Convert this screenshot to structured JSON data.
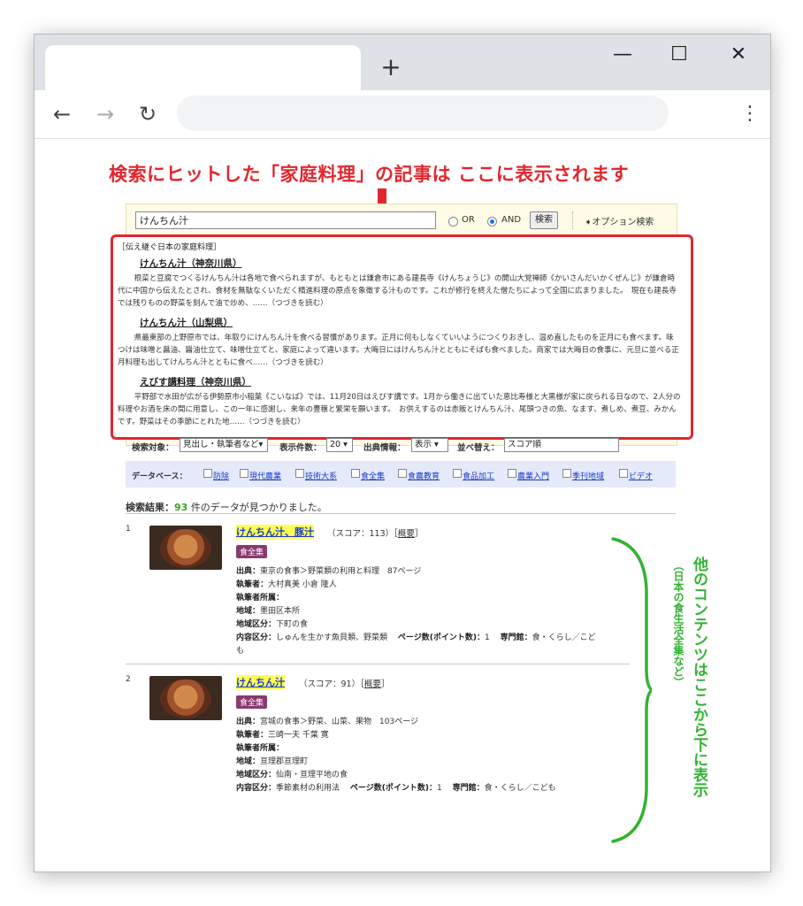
{
  "browser": {
    "new_tab": "+",
    "back": "←",
    "forward": "→",
    "reload": "↻",
    "menu": "⋮",
    "minimize": "—",
    "maximize": "☐",
    "close": "✕"
  },
  "banner": "検索にヒットした「家庭料理」の記事は ここに表示されます",
  "search": {
    "query": "けんちん汁",
    "or_label": "OR",
    "and_label": "AND",
    "submit": "検索",
    "option_link": "➧オプション検索"
  },
  "featured": {
    "heading": "［伝え継ぐ日本の家庭料理］",
    "articles": [
      {
        "title": "けんちん汁（神奈川県）",
        "body": "根菜と豆腐でつくるけんちん汁は各地で食べられますが、もともとは鎌倉市にある建長寺《けんちょうじ》の開山大覚禅師《かいさんだいかくぜんじ》が鎌倉時代に中国から伝えたとされ、食材を無駄なくいただく精進料理の原点を象徴する汁ものです。これが修行を終えた僧たちによって全国に広まりました。　現在も建長寺では残りものの野菜を刻んで油で炒め、……（つづきを読む）"
      },
      {
        "title": "けんちん汁（山梨県）",
        "body": "県最東部の上野原市では、年取りにけんちん汁を食べる習慣があります。正月に何もしなくていいようにつくりおきし、温め直したものを正月にも食べます。味つけは味噌と醤油、醤油仕立て、味噌仕立てと、家庭によって違います。大晦日にはけんちん汁とともにそばも食べました。商家では大晦日の食事に、元旦に並べる正月料理も出してけんちん汁とともに食べ……（つづきを読む）"
      },
      {
        "title": "えびす講料理（神奈川県）",
        "body": "平野部で水田が広がる伊勢原市小稲葉《こいなば》では、11月20日はえびす講です。1月から働きに出ていた恵比寿様と大黒様が家に戻られる日なので、2人分の料理やお酒を床の間に用意し、この一年に感謝し、来年の豊穣と繁栄を願います。　お供えするのは赤飯とけんちん汁、尾頭つきの魚、なます、煮しめ、煮豆、みかんです。野菜はその季節にとれた地……（つづきを読む）"
      }
    ]
  },
  "filters": {
    "target_label": "検索対象：",
    "target_value": "見出し・執筆者など▾",
    "count_label": "表示件数：",
    "count_value": "20 ▾",
    "source_label": "出典情報：",
    "source_value": "表示 ▾",
    "sort_label": "並べ替え：",
    "sort_value": "スコア順"
  },
  "databases": {
    "label": "データベース：",
    "items": [
      "防除",
      "現代農業",
      "技術大系",
      "食全集",
      "食農教育",
      "食品加工",
      "農業入門",
      "季刊地域",
      "ビデオ"
    ]
  },
  "results": {
    "summary_prefix": "検索結果：",
    "count": "93",
    "summary_suffix": "件のデータが見つかりました。",
    "items": [
      {
        "num": "1",
        "title": "けんちん汁、豚汁",
        "score": "（スコア：113）［",
        "abstract": "概要",
        "score_end": "］",
        "tag": "食全集",
        "source_label": "出典：",
        "source": "東京の食事＞野菜類の利用と料理　87ページ",
        "author_label": "執筆者：",
        "author": "大村真美 小倉 隆人",
        "affil_label": "執筆者所属：",
        "affil": "",
        "region_label": "地域：",
        "region": "墨田区本所",
        "region_cls_label": "地域区分：",
        "region_cls": "下町の食",
        "content_label": "内容区分：",
        "content": "しゅんを生かす魚貝類、野菜類　",
        "pages_label": "ページ数(ポイント数)：",
        "pages": "1　",
        "field_label": "専門館：",
        "field": "食・くらし／こども"
      },
      {
        "num": "2",
        "title": "けんちん汁",
        "score": "（スコア：91）［",
        "abstract": "概要",
        "score_end": "］",
        "tag": "食全集",
        "source_label": "出典：",
        "source": "宮城の食事＞野菜、山菜、果物　103ページ",
        "author_label": "執筆者：",
        "author": "三崎一夫 千葉 寛",
        "affil_label": "執筆者所属：",
        "affil": "",
        "region_label": "地域：",
        "region": "亘理郡亘理町",
        "region_cls_label": "地域区分：",
        "region_cls": "仙南・亘理平地の食",
        "content_label": "内容区分：",
        "content": "季節素材の利用法　",
        "pages_label": "ページ数(ポイント数)：",
        "pages": "1　",
        "field_label": "専門館：",
        "field": "食・くらし／こども"
      }
    ]
  },
  "side_note": {
    "main": "他のコンテンツはここから下に表示",
    "sub": "（日本の食生活全集など）"
  },
  "colors": {
    "banner": "#e3262d",
    "frame": "#e0262d",
    "note": "#34b233",
    "link": "#1a3cc9"
  }
}
